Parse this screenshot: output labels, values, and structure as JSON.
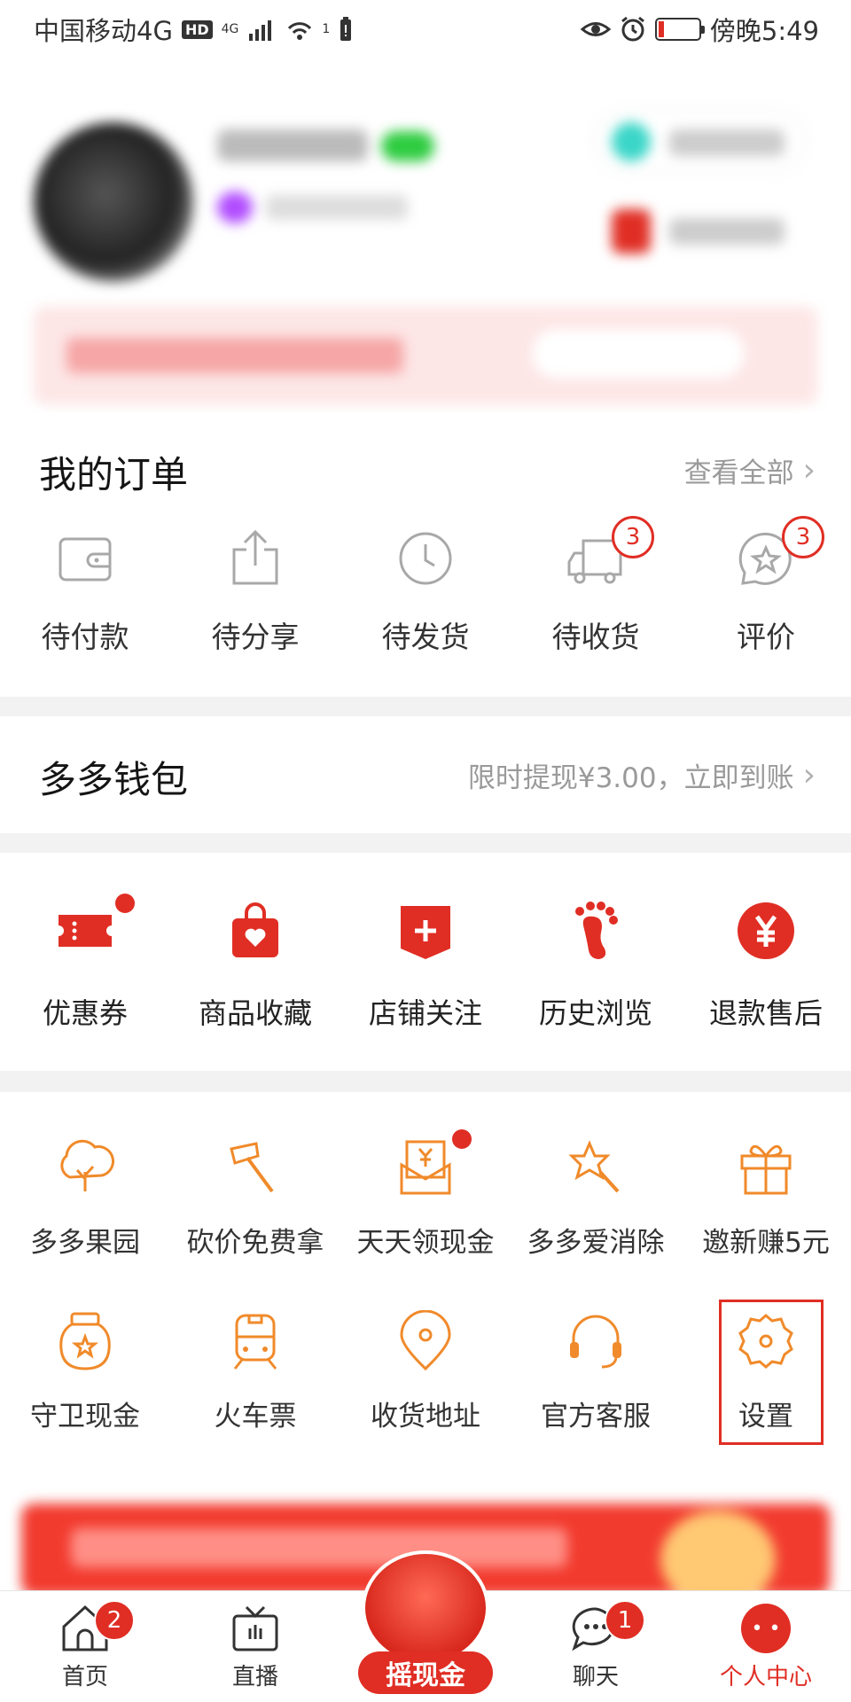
{
  "status_bar": {
    "carrier": "中国移动4G",
    "hd_badge": "HD",
    "net_small": "4G",
    "wifi_sup": "1",
    "time": "傍晚5:49"
  },
  "orders": {
    "title": "我的订单",
    "view_all": "查看全部",
    "items": [
      {
        "label": "待付款",
        "icon": "wallet-icon"
      },
      {
        "label": "待分享",
        "icon": "share-icon"
      },
      {
        "label": "待发货",
        "icon": "clock-icon"
      },
      {
        "label": "待收货",
        "icon": "truck-icon",
        "badge": "3"
      },
      {
        "label": "评价",
        "icon": "review-icon",
        "badge": "3"
      }
    ]
  },
  "wallet": {
    "title": "多多钱包",
    "promo": "限时提现¥3.00，立即到账"
  },
  "services": {
    "items": [
      {
        "label": "优惠券",
        "icon": "coupon-icon",
        "dot": true
      },
      {
        "label": "商品收藏",
        "icon": "favorite-bag-icon"
      },
      {
        "label": "店铺关注",
        "icon": "store-follow-icon"
      },
      {
        "label": "历史浏览",
        "icon": "footprint-icon"
      },
      {
        "label": "退款售后",
        "icon": "refund-icon"
      }
    ]
  },
  "tools": {
    "row1": [
      {
        "label": "多多果园",
        "icon": "tree-icon"
      },
      {
        "label": "砍价免费拿",
        "icon": "axe-icon"
      },
      {
        "label": "天天领现金",
        "icon": "cash-envelope-icon",
        "dot": true
      },
      {
        "label": "多多爱消除",
        "icon": "star-wand-icon"
      },
      {
        "label": "邀新赚5元",
        "icon": "gift-icon"
      }
    ],
    "row2": [
      {
        "label": "守卫现金",
        "icon": "money-jar-icon"
      },
      {
        "label": "火车票",
        "icon": "train-icon"
      },
      {
        "label": "收货地址",
        "icon": "location-pin-icon"
      },
      {
        "label": "官方客服",
        "icon": "headset-icon"
      },
      {
        "label": "设置",
        "icon": "settings-gear-icon"
      }
    ]
  },
  "tabbar": {
    "items": [
      {
        "label": "首页",
        "icon": "home-icon",
        "badge": "2"
      },
      {
        "label": "直播",
        "icon": "tv-icon"
      },
      {
        "label": "摇现金",
        "icon": "shake-cash-icon"
      },
      {
        "label": "聊天",
        "icon": "chat-icon",
        "badge": "1"
      },
      {
        "label": "个人中心",
        "icon": "profile-icon"
      }
    ]
  },
  "colors": {
    "accent": "#e02e24",
    "orange": "#f08a2a",
    "icon_gray": "#a8a8a8"
  }
}
